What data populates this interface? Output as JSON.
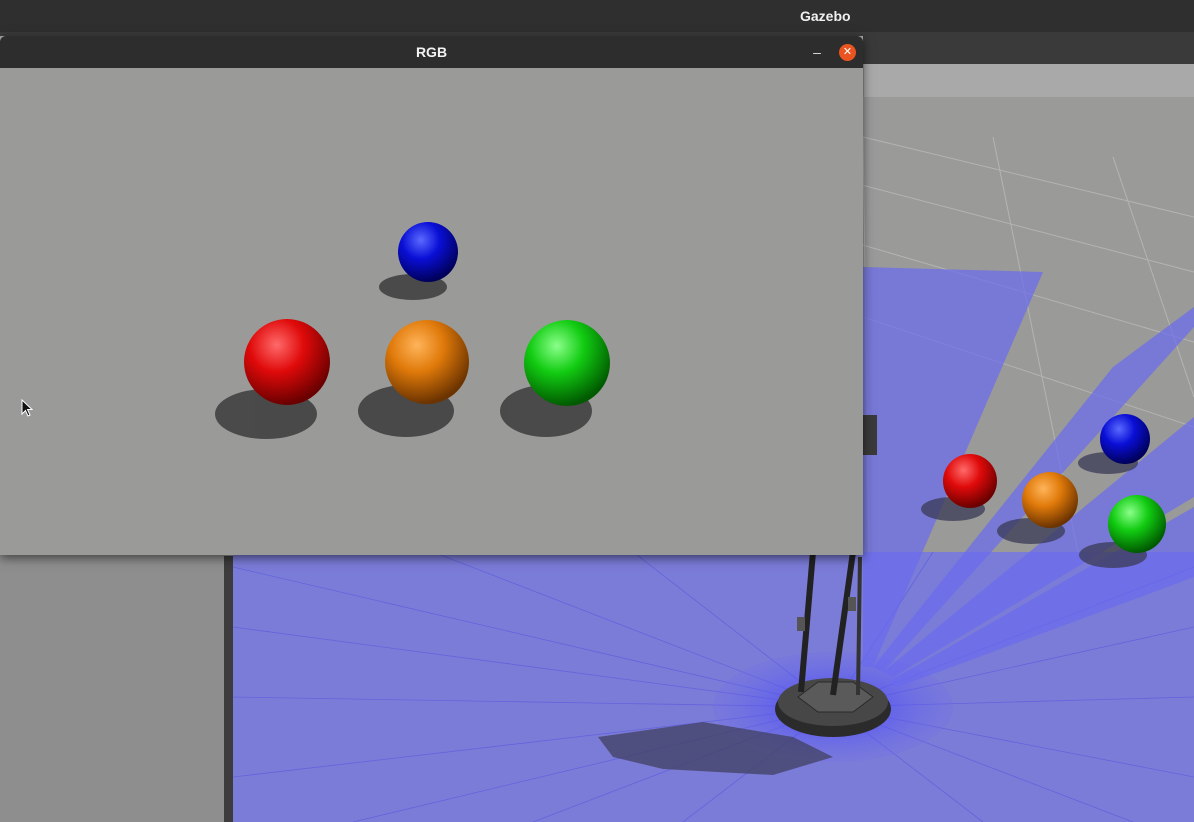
{
  "desktop": {
    "active_app": "Gazebo"
  },
  "rgb_window": {
    "title": "RGB",
    "controls": {
      "minimize": "minimize-icon",
      "close": "close-icon"
    },
    "camera_view": {
      "spheres": [
        {
          "color_name": "blue",
          "color": "#0a0fd6"
        },
        {
          "color_name": "red",
          "color": "#e00a0a"
        },
        {
          "color_name": "orange",
          "color": "#e07a0a"
        },
        {
          "color_name": "green",
          "color": "#12cc12"
        }
      ]
    }
  },
  "gazebo_scene": {
    "spheres": [
      {
        "color_name": "red",
        "color": "#e00a0a"
      },
      {
        "color_name": "orange",
        "color": "#e07a0a"
      },
      {
        "color_name": "blue",
        "color": "#0a0fd6"
      },
      {
        "color_name": "green",
        "color": "#12cc12"
      }
    ],
    "laser_color": "#6a6af0",
    "robot": "mobile-robot"
  },
  "colors": {
    "topbar": "#2f2f2f",
    "close_button": "#e95420",
    "ground": "#9a9a99"
  }
}
